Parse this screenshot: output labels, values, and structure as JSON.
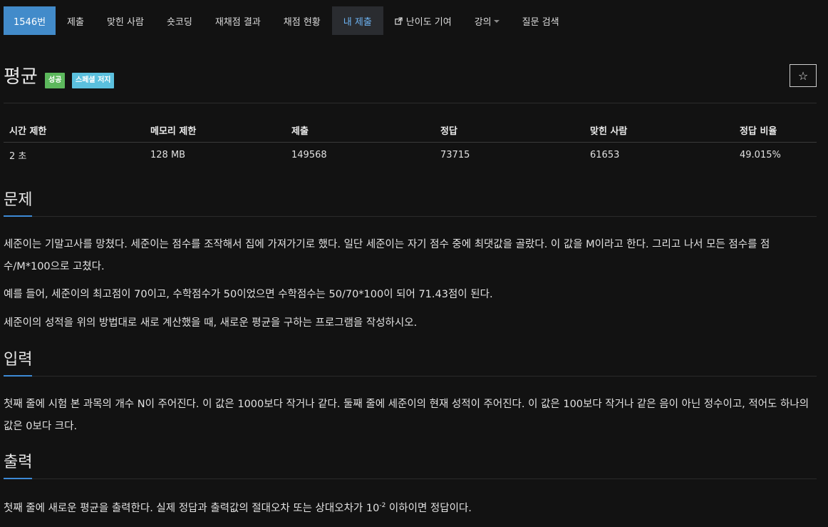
{
  "nav": {
    "problem_number": "1546번",
    "items": [
      "제출",
      "맞힌 사람",
      "숏코딩",
      "재채점 결과",
      "채점 현황",
      "내 제출",
      "난이도 기여",
      "강의",
      "질문 검색"
    ]
  },
  "problem": {
    "title": "평균",
    "badges": [
      "성공",
      "스페셜 저지"
    ],
    "star": "☆"
  },
  "table": {
    "headers": [
      "시간 제한",
      "메모리 제한",
      "제출",
      "정답",
      "맞힌 사람",
      "정답 비율"
    ],
    "values": [
      "2 초",
      "128 MB",
      "149568",
      "73715",
      "61653",
      "49.015%"
    ]
  },
  "sections": {
    "description": {
      "heading": "문제",
      "p1": "세준이는 기말고사를 망쳤다. 세준이는 점수를 조작해서 집에 가져가기로 했다. 일단 세준이는 자기 점수 중에 최댓값을 골랐다. 이 값을 M이라고 한다. 그리고 나서 모든 점수를 점수/M*100으로 고쳤다.",
      "p2": "예를 들어, 세준이의 최고점이 70이고, 수학점수가 50이었으면 수학점수는 50/70*100이 되어 71.43점이 된다.",
      "p3": "세준이의 성적을 위의 방법대로 새로 계산했을 때, 새로운 평균을 구하는 프로그램을 작성하시오."
    },
    "input": {
      "heading": "입력",
      "p1": "첫째 줄에 시험 본 과목의 개수 N이 주어진다. 이 값은 1000보다 작거나 같다. 둘째 줄에 세준이의 현재 성적이 주어진다. 이 값은 100보다 작거나 같은 음이 아닌 정수이고, 적어도 하나의 값은 0보다 크다."
    },
    "output": {
      "heading": "출력",
      "p1_before": "첫째 줄에 새로운 평균을 출력한다. 실제 정답과 출력값의 절대오차 또는 상대오차가 10",
      "p1_sup": "-2",
      "p1_after": " 이하이면 정답이다."
    }
  },
  "colors": {
    "background": "#121212",
    "primary": "#428bca",
    "active_text": "#6db3f2",
    "success": "#5cb85c",
    "info": "#5bc0de",
    "accent": "#3d8ad6"
  }
}
